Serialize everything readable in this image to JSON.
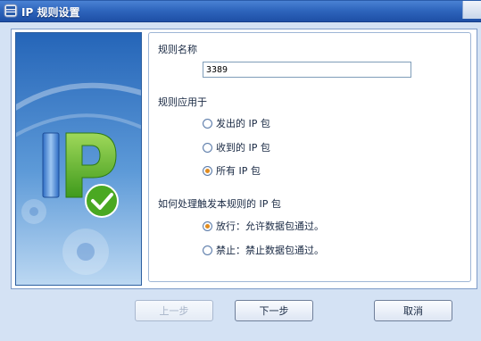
{
  "window": {
    "title": "IP 规则设置"
  },
  "form": {
    "rule_name_label": "规则名称",
    "rule_name_value": "3389",
    "apply_to_label": "规则应用于",
    "apply_to_options": [
      {
        "label": "发出的 IP 包",
        "checked": false
      },
      {
        "label": "收到的 IP 包",
        "checked": false
      },
      {
        "label": "所有 IP 包",
        "checked": true
      }
    ],
    "action_label": "如何处理触发本规则的 IP 包",
    "action_options": [
      {
        "label": "放行：允许数据包通过。",
        "checked": true
      },
      {
        "label": "禁止：禁止数据包通过。",
        "checked": false
      }
    ]
  },
  "buttons": {
    "prev_label": "上一步",
    "next_label": "下一步",
    "cancel_label": "取消"
  },
  "colors": {
    "title_bar": "#2f66bd",
    "window_bg": "#d4e2f4",
    "radio_accent": "#e08b1e",
    "banner_blue": "#2a6cc0",
    "check_green": "#5bb82a"
  },
  "icons": [
    "app-icon",
    "ip-logo-icon",
    "checkmark-icon",
    "gear-icon"
  ]
}
